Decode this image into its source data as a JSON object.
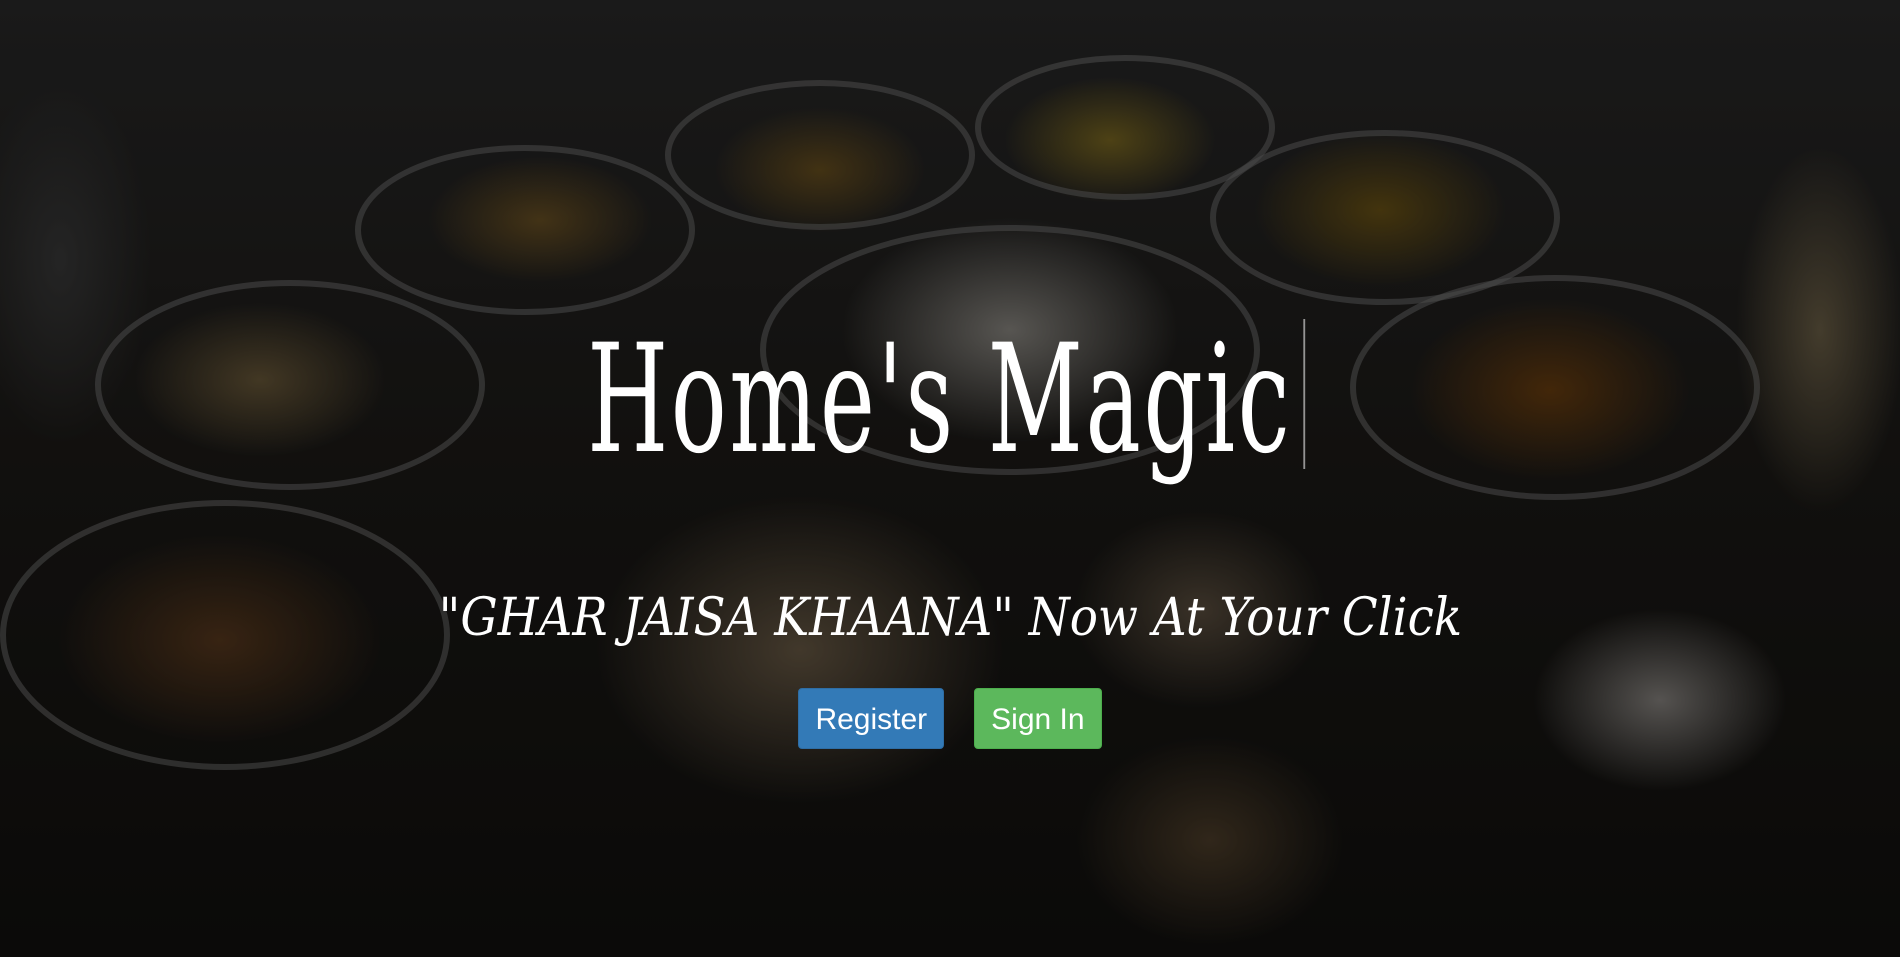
{
  "hero": {
    "title": "Home's Magic",
    "tagline": "\"GHAR JAISA KHAANA\" Now At Your Click",
    "background_image": "thali-meal-photo"
  },
  "actions": {
    "register_label": "Register",
    "signin_label": "Sign In"
  },
  "colors": {
    "register_button": "#337ab7",
    "signin_button": "#5cb85c",
    "text": "#ffffff"
  }
}
